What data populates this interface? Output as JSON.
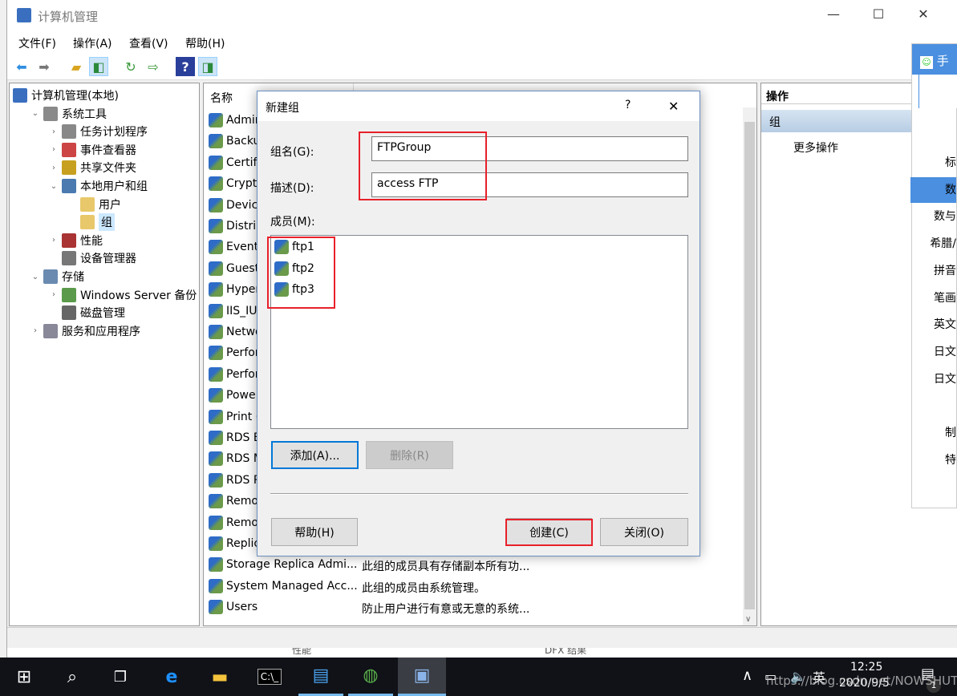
{
  "window": {
    "title": "计算机管理",
    "minimize": "—",
    "maximize": "☐",
    "close": "✕"
  },
  "menu": [
    "文件(F)",
    "操作(A)",
    "查看(V)",
    "帮助(H)"
  ],
  "toolbar": [
    "back-icon",
    "forward-icon",
    "up-folder-icon",
    "show-hide-tree-icon",
    "refresh-icon",
    "export-list-icon",
    "help-icon",
    "show-action-pane-icon"
  ],
  "tree": [
    {
      "label": "计算机管理(本地)",
      "level": 0
    },
    {
      "label": "系统工具",
      "level": 1,
      "expanded": true
    },
    {
      "label": "任务计划程序",
      "level": 2
    },
    {
      "label": "事件查看器",
      "level": 2
    },
    {
      "label": "共享文件夹",
      "level": 2
    },
    {
      "label": "本地用户和组",
      "level": 2,
      "expanded": true
    },
    {
      "label": "用户",
      "level": 3
    },
    {
      "label": "组",
      "level": 3,
      "selected": true
    },
    {
      "label": "性能",
      "level": 2
    },
    {
      "label": "设备管理器",
      "level": 2
    },
    {
      "label": "存储",
      "level": 1,
      "expanded": true
    },
    {
      "label": "Windows Server 备份",
      "level": 2
    },
    {
      "label": "磁盘管理",
      "level": 2
    },
    {
      "label": "服务和应用程序",
      "level": 1
    }
  ],
  "list": {
    "header_name": "名称",
    "rows": [
      {
        "name": "Admin",
        "desc": ""
      },
      {
        "name": "Backu",
        "desc": ""
      },
      {
        "name": "Certif",
        "desc": ""
      },
      {
        "name": "Crypto",
        "desc": ""
      },
      {
        "name": "Devic",
        "desc": ""
      },
      {
        "name": "Distrib",
        "desc": ""
      },
      {
        "name": "Event",
        "desc": ""
      },
      {
        "name": "Guest",
        "desc": ""
      },
      {
        "name": "Hyper",
        "desc": ""
      },
      {
        "name": "IIS_IU",
        "desc": ""
      },
      {
        "name": "Netwo",
        "desc": ""
      },
      {
        "name": "Perfor",
        "desc": ""
      },
      {
        "name": "Perfor",
        "desc": ""
      },
      {
        "name": "Powe",
        "desc": ""
      },
      {
        "name": "Print (",
        "desc": ""
      },
      {
        "name": "RDS E",
        "desc": ""
      },
      {
        "name": "RDS M",
        "desc": ""
      },
      {
        "name": "RDS R",
        "desc": ""
      },
      {
        "name": "Remo",
        "desc": ""
      },
      {
        "name": "Remo",
        "desc": ""
      },
      {
        "name": "Replic",
        "desc": ""
      },
      {
        "name": "Storage Replica Admi...",
        "desc": "此组的成员具有存储副本所有功..."
      },
      {
        "name": "System Managed Acc...",
        "desc": "此组的成员由系统管理。"
      },
      {
        "name": "Users",
        "desc": "防止用户进行有意或无意的系统..."
      }
    ]
  },
  "actions": {
    "header": "操作",
    "section": "组",
    "more": "更多操作"
  },
  "dialog": {
    "title": "新建组",
    "help_q": "?",
    "close": "✕",
    "group_name_label": "组名(G):",
    "group_name": "FTPGroup",
    "desc_label": "描述(D):",
    "desc": "access FTP",
    "members_label": "成员(M):",
    "members": [
      "ftp1",
      "ftp2",
      "ftp3"
    ],
    "add": "添加(A)...",
    "remove": "删除(R)",
    "help": "帮助(H)",
    "create": "创建(C)",
    "close_btn": "关闭(O)"
  },
  "ime": {
    "title": "手",
    "items": [
      "标",
      "数",
      "数与",
      "希腊/",
      "拼音",
      "笔画",
      "英文",
      "日文",
      "日文",
      "",
      "制",
      "特"
    ]
  },
  "bg_strip": [
    "性能",
    "DFX 结果"
  ],
  "taskbar": {
    "icons": [
      "start-icon",
      "search-icon",
      "task-view-icon",
      "ie-icon",
      "file-explorer-icon",
      "cmd-icon",
      "server-manager-icon",
      "iis-manager-icon",
      "computer-management-icon"
    ],
    "ime_indicator": "英",
    "time": "12:25",
    "date": "2020/9/5",
    "notification_count": "1"
  },
  "watermark": "https://blog.csdn.net/NOWSHUT"
}
